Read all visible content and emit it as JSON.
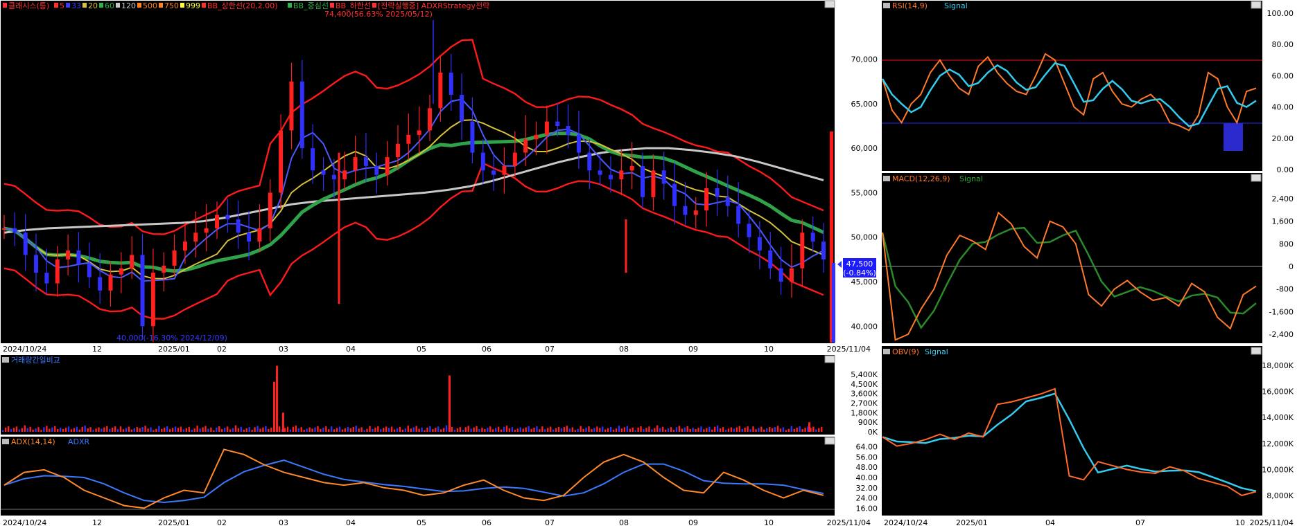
{
  "colors": {
    "bg": "#000000",
    "panel_bg": "#ffffff",
    "candle_up": "#ff2020",
    "candle_down": "#3030ff",
    "bb": "#ff1a1a",
    "ma5": "#3a3aff",
    "ma20": "#d8c23a",
    "ma60": "#2fb24a",
    "ma120": "#c8c8c8",
    "ma500": "#ff8020",
    "rsi_line": "#ff7a2a",
    "signal": "#33ccee",
    "macd_line": "#ff7a2a",
    "macd_signal": "#2a8a2a",
    "adx": "#ff8a2a",
    "adxr": "#3a7aff",
    "obv": "#ff6a2a"
  },
  "main": {
    "legend": [
      {
        "text": "클래시스(틍)",
        "color": "#ff3030"
      },
      {
        "text": "5",
        "color": "#ff3030"
      },
      {
        "text": "33",
        "color": "#3a3aff"
      },
      {
        "text": "20",
        "color": "#d8c23a"
      },
      {
        "text": "60",
        "color": "#2fb24a"
      },
      {
        "text": "120",
        "color": "#c8c8c8"
      },
      {
        "text": "500",
        "color": "#ff8020"
      },
      {
        "text": "750",
        "color": "#ff8020"
      },
      {
        "text": "999",
        "color": "#ffff40"
      },
      {
        "text": "BB_상한선(20,2.00)",
        "color": "#ff3030"
      },
      {
        "text": "BB_중심선",
        "color": "#2fb24a"
      },
      {
        "text": "BB_하한선",
        "color": "#ff3030"
      },
      {
        "text": "[전략실행중] ADXRStrategy전략",
        "color": "#ff3030"
      }
    ],
    "high_note": "74,400(56.63% 2025/05/12)",
    "low_note": "40,000(-16.30% 2024/12/09)",
    "price_ticks": [
      "70,000",
      "65,000",
      "60,000",
      "55,000",
      "50,000",
      "45,000",
      "40,000"
    ],
    "current_price": "47,500",
    "current_change": "(-0.84%)",
    "x_labels": [
      "2024/10/24",
      "12",
      "2025/01",
      "02",
      "03",
      "04",
      "05",
      "06",
      "07",
      "08",
      "09",
      "10",
      "2025/11/04"
    ]
  },
  "volume": {
    "title": "거래량간일비교",
    "ticks": [
      "5,400K",
      "4,500K",
      "3,600K",
      "2,700K",
      "1,800K",
      "900K",
      "0K"
    ]
  },
  "adx": {
    "title": "ADX(14,14)",
    "title2": "ADXR",
    "ticks": [
      "64.00",
      "56.00",
      "48.00",
      "40.00",
      "32.00",
      "24.00",
      "16.00"
    ]
  },
  "rsi": {
    "title": "RSI(14,9)",
    "title2": "Signal",
    "ticks": [
      "100.00",
      "80.00",
      "60.00",
      "40.00",
      "20.00",
      "0.00"
    ]
  },
  "macd": {
    "title": "MACD(12,26,9)",
    "title2": "Signal",
    "ticks": [
      "2,400",
      "1,600",
      "800",
      "0",
      "-800",
      "-1,600",
      "-2,400"
    ]
  },
  "obv": {
    "title": "OBV(9)",
    "title2": "Signal",
    "ticks": [
      "18,000K",
      "16,000K",
      "14,000K",
      "12,000K",
      "10,000K",
      "8,000K"
    ],
    "x_labels": [
      "2024/10/24",
      "2025/01",
      "04",
      "07",
      "10",
      "2025/11/04"
    ]
  },
  "chart_data": {
    "type": "line",
    "xlim": [
      "2024/10/24",
      "2025/11/04"
    ],
    "months": [
      "2024/10/24",
      "12",
      "2025/01",
      "02",
      "03",
      "04",
      "05",
      "06",
      "07",
      "08",
      "09",
      "10",
      "2025/11/04"
    ],
    "price_close": [
      51000,
      50500,
      48000,
      46000,
      44800,
      47500,
      48500,
      47000,
      45500,
      44000,
      45800,
      46500,
      48000,
      40000,
      46000,
      46800,
      48500,
      49500,
      50500,
      51000,
      52500,
      52000,
      50500,
      49500,
      51000,
      55000,
      62000,
      67500,
      60000,
      57500,
      57000,
      56500,
      57500,
      59000,
      58000,
      57000,
      59000,
      60500,
      61500,
      62000,
      64500,
      68500,
      66000,
      63000,
      59500,
      57500,
      57000,
      58000,
      59500,
      61000,
      61500,
      63000,
      62500,
      61500,
      59500,
      57500,
      57000,
      56500,
      57500,
      58000,
      54500,
      57500,
      56000,
      53500,
      52500,
      53000,
      55500,
      54500,
      53500,
      51500,
      50000,
      48500,
      46500,
      45000,
      46500,
      50500,
      49500,
      47500
    ],
    "ma_long": [
      50500,
      50800,
      51000,
      51100,
      51200,
      51300,
      51400,
      51500,
      51600,
      51800,
      52200,
      52700,
      53200,
      53700,
      54000,
      54200,
      54400,
      54600,
      54800,
      55000,
      55300,
      55700,
      56300,
      57000,
      57700,
      58400,
      59000,
      59500,
      59800,
      60000,
      60000,
      59800,
      59500,
      59100,
      58500,
      57800,
      57100,
      56400
    ],
    "rsi": [
      58,
      38,
      30,
      42,
      48,
      62,
      70,
      60,
      52,
      48,
      66,
      72,
      62,
      55,
      50,
      48,
      60,
      74,
      70,
      55,
      40,
      35,
      58,
      62,
      50,
      42,
      40,
      45,
      48,
      42,
      30,
      28,
      25,
      35,
      62,
      58,
      40,
      30,
      50,
      52
    ],
    "macd": [
      1200,
      -2600,
      -2400,
      -1500,
      -800,
      400,
      1100,
      900,
      600,
      1900,
      1500,
      700,
      300,
      1600,
      1400,
      800,
      -1000,
      -1400,
      -800,
      -500,
      -900,
      -1200,
      -1100,
      -1400,
      -600,
      -900,
      -1800,
      -2200,
      -1000,
      -700
    ],
    "obv": [
      12500,
      11800,
      12000,
      12300,
      12700,
      12300,
      12800,
      12500,
      15000,
      15200,
      15500,
      15800,
      16200,
      9500,
      9200,
      10600,
      10300,
      10000,
      9800,
      9700,
      10200,
      9900,
      9300,
      9000,
      8700,
      8000,
      8300
    ],
    "adx": [
      34,
      44,
      46,
      40,
      30,
      24,
      18,
      16,
      24,
      30,
      28,
      62,
      58,
      50,
      44,
      40,
      36,
      34,
      36,
      32,
      30,
      26,
      28,
      34,
      38,
      30,
      24,
      22,
      26,
      40,
      52,
      58,
      52,
      40,
      30,
      28,
      44,
      38,
      30,
      24,
      30,
      26
    ],
    "volume_peaks_k": [
      6200,
      5300
    ]
  }
}
